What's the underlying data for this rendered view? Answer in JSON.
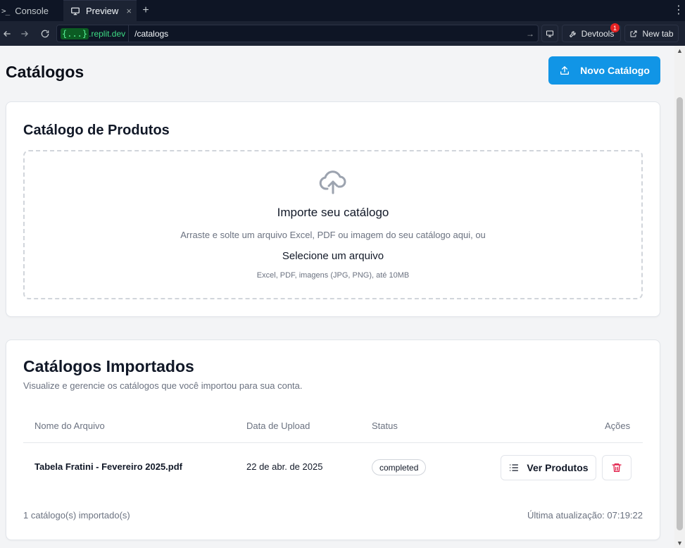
{
  "browser": {
    "tabs": [
      {
        "label": "Console",
        "prompt_glyph": ">_"
      },
      {
        "label": "Preview"
      }
    ],
    "new_tab_glyph": "+",
    "menu_glyph": "⋮",
    "url": {
      "domain_chip": "{...}",
      "domain": ".replit.dev",
      "path": "/catalogs"
    },
    "devtools_label": "Devtools",
    "devtools_badge": "1",
    "newtab_label": "New tab"
  },
  "page": {
    "title": "Catálogos",
    "new_button": "Novo Catálogo"
  },
  "upload": {
    "title": "Catálogo de Produtos",
    "heading": "Importe seu catálogo",
    "description": "Arraste e solte um arquivo Excel, PDF ou imagem do seu catálogo aqui, ou",
    "select": "Selecione um arquivo",
    "hint": "Excel, PDF, imagens (JPG, PNG), até 10MB"
  },
  "imported": {
    "title": "Catálogos Importados",
    "subtitle": "Visualize e gerencie os catálogos que você importou para sua conta.",
    "columns": [
      "Nome do Arquivo",
      "Data de Upload",
      "Status",
      "Ações"
    ],
    "rows": [
      {
        "file": "Tabela Fratini - Fevereiro 2025.pdf",
        "date": "22 de abr. de 2025",
        "status": "completed",
        "view_label": "Ver Produtos"
      }
    ],
    "count_text": "1 catálogo(s) importado(s)",
    "updated_text": "Última atualização: 07:19:22"
  },
  "colors": {
    "primary": "#1195e6",
    "danger": "#e11d48",
    "chrome": "#0e1525"
  }
}
